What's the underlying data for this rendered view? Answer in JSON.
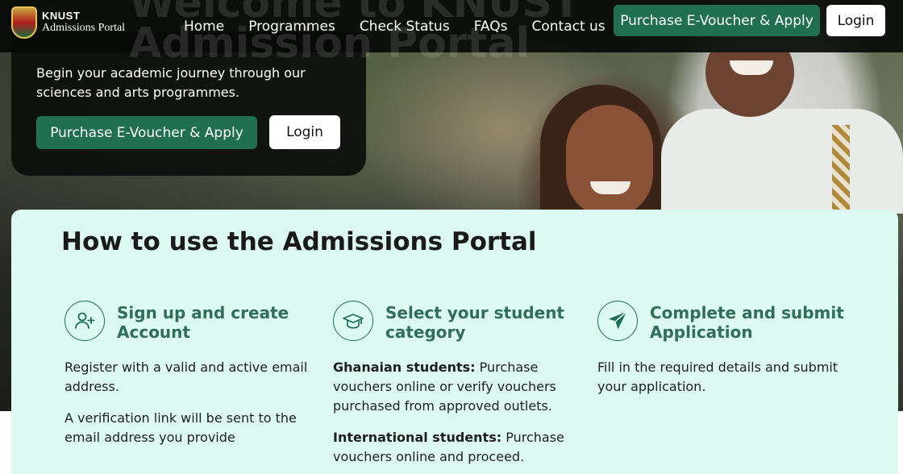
{
  "navbar": {
    "logo_title": "KNUST",
    "logo_subtitle": "Admissions Portal",
    "ghost_line1": "Welcome to KNUST",
    "ghost_line2": "Admission Portal",
    "links": [
      "Home",
      "Programmes",
      "Check Status",
      "FAQs",
      "Contact us"
    ],
    "cta_label": "Purchase E-Voucher & Apply",
    "login_label": "Login"
  },
  "hero": {
    "description": "Begin your academic journey through our sciences and arts programmes.",
    "cta_label": "Purchase E-Voucher & Apply",
    "login_label": "Login"
  },
  "howto": {
    "title": "How to use the Admissions Portal",
    "steps": [
      {
        "icon": "user-add-icon",
        "title": "Sign up and create Account",
        "paragraphs": [
          {
            "bold": "",
            "text": "Register with a valid and active email address."
          },
          {
            "bold": "",
            "text": "A verification link will be sent to the email address you provide"
          }
        ]
      },
      {
        "icon": "graduation-cap-icon",
        "title": "Select your student category",
        "paragraphs": [
          {
            "bold": "Ghanaian students:",
            "text": " Purchase vouchers online or verify vouchers purchased from approved outlets."
          },
          {
            "bold": "International students:",
            "text": " Purchase vouchers online and proceed."
          }
        ]
      },
      {
        "icon": "send-icon",
        "title": "Complete and submit Application",
        "paragraphs": [
          {
            "bold": "",
            "text": "Fill in the required details and submit your application."
          }
        ]
      }
    ]
  },
  "colors": {
    "brand_green": "#1f6f50",
    "panel_bg": "#dcfaf1",
    "step_title": "#2f6f57"
  }
}
